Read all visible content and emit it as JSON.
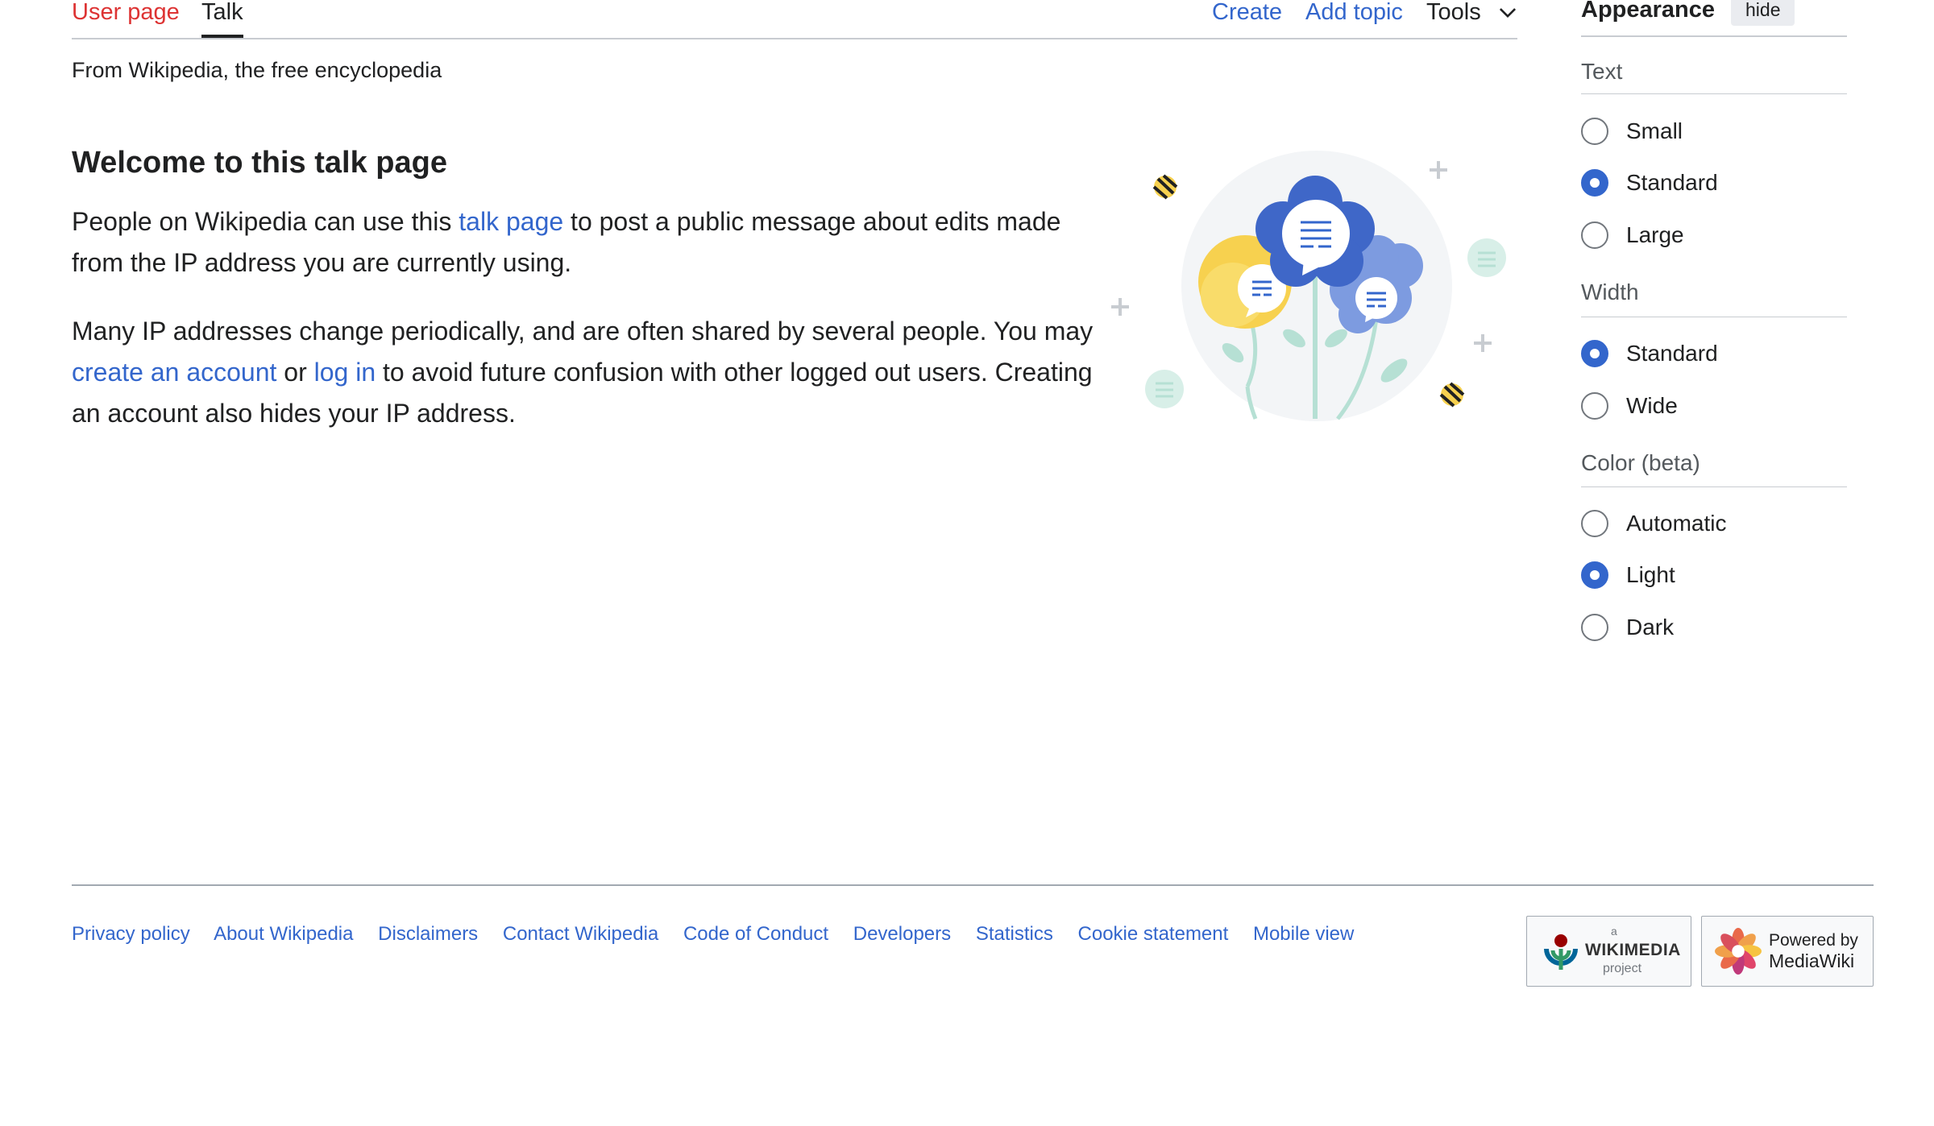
{
  "tabs": {
    "user_page": "User page",
    "talk": "Talk",
    "create": "Create",
    "add_topic": "Add topic",
    "tools": "Tools"
  },
  "tagline": "From Wikipedia, the free encyclopedia",
  "content": {
    "heading": "Welcome to this talk page",
    "para1": {
      "t1": "People on Wikipedia can use this ",
      "link_talk": "talk page",
      "t2": " to post a public message about edits made from the IP address you are currently using."
    },
    "para2": {
      "t1": "Many IP addresses change periodically, and are often shared by several people. You may ",
      "link_create": "create an account",
      "t2": " or ",
      "link_login": "log in",
      "t3": " to avoid future confusion with other logged out users. Creating an account also hides your IP address."
    }
  },
  "appearance": {
    "title": "Appearance",
    "hide": "hide",
    "text": {
      "label": "Text",
      "options": [
        "Small",
        "Standard",
        "Large"
      ],
      "selected": "Standard"
    },
    "width": {
      "label": "Width",
      "options": [
        "Standard",
        "Wide"
      ],
      "selected": "Standard"
    },
    "color": {
      "label": "Color (beta)",
      "options": [
        "Automatic",
        "Light",
        "Dark"
      ],
      "selected": "Light"
    }
  },
  "footer": {
    "links": [
      "Privacy policy",
      "About Wikipedia",
      "Disclaimers",
      "Contact Wikipedia",
      "Code of Conduct",
      "Developers",
      "Statistics",
      "Cookie statement",
      "Mobile view"
    ],
    "wikimedia_badge": {
      "a": "a",
      "name": "WIKIMEDIA",
      "project": "project"
    },
    "mediawiki_badge": {
      "line1": "Powered by",
      "line2": "MediaWiki"
    }
  },
  "colors": {
    "link": "#3366cc",
    "new_link": "#dd3333",
    "radio_checked": "#3366cc"
  }
}
